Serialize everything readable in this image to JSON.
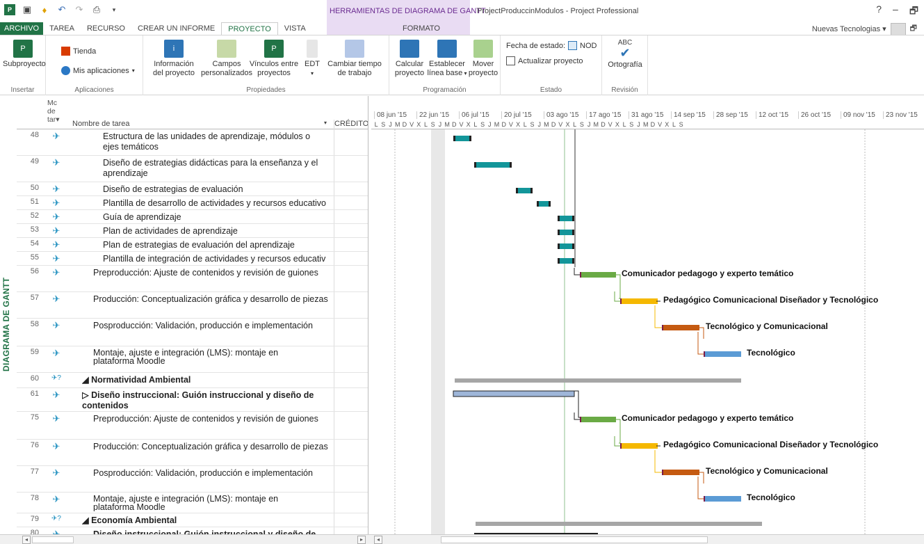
{
  "window": {
    "title": "ProjectProduccinModulos - Project Professional",
    "contextual_group": "HERRAMIENTAS DE DIAGRAMA DE GANTT",
    "help": "?",
    "minimize": "–",
    "restore": "🗗"
  },
  "tabs": [
    {
      "label": "ARCHIVO"
    },
    {
      "label": "TAREA"
    },
    {
      "label": "RECURSO"
    },
    {
      "label": "CREAR UN INFORME"
    },
    {
      "label": "PROYECTO"
    },
    {
      "label": "VISTA"
    }
  ],
  "contextual_tab": "FORMATO",
  "account": {
    "name": "Nuevas Tecnologias ▾"
  },
  "ribbon": {
    "insertar": {
      "label": "Insertar",
      "subproyecto": "Subproyecto"
    },
    "aplicaciones": {
      "label": "Aplicaciones",
      "tienda": "Tienda",
      "mis_apps": "Mis aplicaciones"
    },
    "propiedades": {
      "label": "Propiedades",
      "info1": "Información",
      "info2": "del proyecto",
      "campos1": "Campos",
      "campos2": "personalizados",
      "vinc1": "Vínculos entre",
      "vinc2": "proyectos",
      "edt": "EDT",
      "cambiar1": "Cambiar tiempo",
      "cambiar2": "de trabajo"
    },
    "programacion": {
      "label": "Programación",
      "calc1": "Calcular",
      "calc2": "proyecto",
      "est1": "Establecer",
      "est2": "línea base",
      "mover1": "Mover",
      "mover2": "proyecto"
    },
    "estado": {
      "label": "Estado",
      "fecha": "Fecha de estado:",
      "fecha_val": "NOD",
      "actualizar": "Actualizar proyecto"
    },
    "revision": {
      "label": "Revisión",
      "ortografia": "Ortografía",
      "abc": "ABC"
    }
  },
  "side_label": "DIAGRAMA DE GANTT",
  "grid": {
    "col_mode1": "Mc",
    "col_mode2": "de",
    "col_mode3": "tar▾",
    "col_name": "Nombre de tarea",
    "col_credit": "CRÉDITO",
    "rows": [
      {
        "id": "48",
        "l1": "Estructura de las unidades de aprendizaje, módulos o",
        "l2": "ejes temáticos"
      },
      {
        "id": "49",
        "l1": "Diseño de estrategias didácticas para la enseñanza y el",
        "l2": "aprendizaje"
      },
      {
        "id": "50",
        "l1": "Diseño de estrategias de evaluación",
        "l2": ""
      },
      {
        "id": "51",
        "l1": "Plantilla de desarrollo de actividades y recursos educativo",
        "l2": ""
      },
      {
        "id": "52",
        "l1": "Guía de aprendizaje",
        "l2": ""
      },
      {
        "id": "53",
        "l1": "Plan de actividades de aprendizaje",
        "l2": ""
      },
      {
        "id": "54",
        "l1": "Plan de estrategias de evaluación del aprendizaje",
        "l2": ""
      },
      {
        "id": "55",
        "l1": "Plantilla de integración de actividades y recursos educativ",
        "l2": ""
      },
      {
        "id": "56",
        "l1": "Preproducción:  Ajuste de contenidos y revisión de guiones",
        "l2": ""
      },
      {
        "id": "57",
        "l1": "Producción: Conceptualización gráfica y desarrollo de piezas",
        "l2": ""
      },
      {
        "id": "58",
        "l1": "Posproducción: Validación, producción e implementación",
        "l2": ""
      },
      {
        "id": "59",
        "l1": "Montaje, ajuste e integración (LMS): montaje en",
        "l2": "plataforma Moodle"
      },
      {
        "id": "60",
        "l1": "◢ Normatividad Ambiental",
        "l2": ""
      },
      {
        "id": "61",
        "l1": "▷ Diseño instruccional: Guión instruccional y diseño de",
        "l2": "contenidos"
      },
      {
        "id": "75",
        "l1": "Preproducción:  Ajuste de contenidos y revisión de guiones",
        "l2": ""
      },
      {
        "id": "76",
        "l1": "Producción: Conceptualización gráfica y desarrollo de piezas",
        "l2": ""
      },
      {
        "id": "77",
        "l1": "Posproducción: Validación, producción e implementación",
        "l2": ""
      },
      {
        "id": "78",
        "l1": "Montaje, ajuste e integración (LMS): montaje en",
        "l2": "plataforma Moodle"
      },
      {
        "id": "79",
        "l1": "◢ Economía Ambiental",
        "l2": ""
      },
      {
        "id": "80",
        "l1": "Diseño instruccional: Guión instruccional y diseño de",
        "l2": ""
      }
    ]
  },
  "timescale": {
    "weeks": [
      "08 jun '15",
      "22 jun '15",
      "06 jul '15",
      "20 jul '15",
      "03 ago '15",
      "17 ago '15",
      "31 ago '15",
      "14 sep '15",
      "28 sep '15",
      "12 oct '15",
      "26 oct '15",
      "09 nov '15",
      "23 nov '15"
    ],
    "days": [
      "L",
      "S",
      "J",
      "M",
      "D",
      "V",
      "X",
      "L",
      "S",
      "J",
      "M",
      "D",
      "V",
      "X",
      "L",
      "S",
      "J",
      "M",
      "D",
      "V",
      "X",
      "L",
      "S",
      "J",
      "M",
      "D",
      "V",
      "X",
      "L",
      "S",
      "J",
      "M",
      "D",
      "V",
      "X",
      "L",
      "S",
      "J",
      "M",
      "D",
      "V",
      "X",
      "L",
      "S"
    ]
  },
  "resources": {
    "r1": "Comunicador pedagogo y experto temático",
    "r2": "Pedagógico Comunicacional Diseñador y Tecnológico",
    "r3": "Tecnológico y Comunicacional",
    "r4": "Tecnológico"
  },
  "colors": {
    "accent": "#217346",
    "contextual": "#6b2c91",
    "task_teal": "#13969a",
    "green_bar": "#6aaa45",
    "yellow_bar": "#f5b800",
    "orange_bar": "#c55a11",
    "blue_bar": "#5b9bd5",
    "summary_gray": "#a6a6a6"
  }
}
